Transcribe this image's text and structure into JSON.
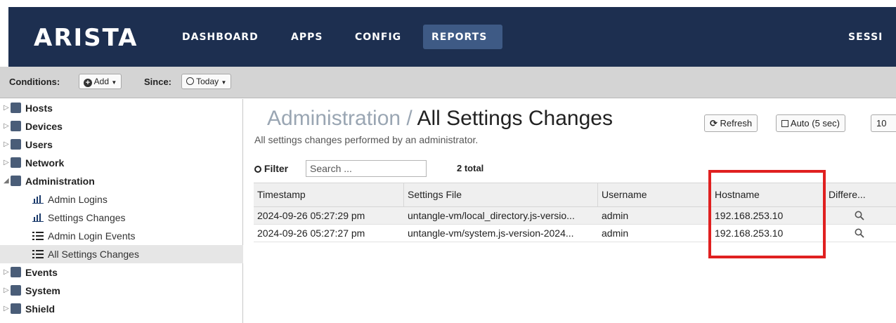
{
  "brand": {
    "logo": "ARISTA"
  },
  "nav": {
    "items": [
      "DASHBOARD",
      "APPS",
      "CONFIG",
      "REPORTS",
      "SESSI"
    ],
    "active": "REPORTS"
  },
  "toolbar": {
    "conditions_label": "Conditions:",
    "add_label": "Add",
    "since_label": "Since:",
    "since_value": "Today"
  },
  "sidebar": {
    "items": [
      {
        "label": "Hosts",
        "arrow": "▷"
      },
      {
        "label": "Devices",
        "arrow": "▷"
      },
      {
        "label": "Users",
        "arrow": "▷"
      },
      {
        "label": "Network",
        "arrow": "▷"
      },
      {
        "label": "Administration",
        "arrow": "◢"
      }
    ],
    "sub_items": [
      {
        "label": "Admin Logins",
        "icon": "bar-chart-icon"
      },
      {
        "label": "Settings Changes",
        "icon": "bar-chart-icon"
      },
      {
        "label": "Admin Login Events",
        "icon": "list-icon"
      },
      {
        "label": "All Settings Changes",
        "icon": "list-icon",
        "selected": true
      }
    ],
    "more_items": [
      {
        "label": "Events",
        "arrow": "▷"
      },
      {
        "label": "System",
        "arrow": "▷"
      },
      {
        "label": "Shield",
        "arrow": "▷"
      }
    ]
  },
  "header": {
    "parent": "Administration",
    "separator": "/",
    "title": "All Settings Changes",
    "subtitle": "All settings changes performed by an administrator."
  },
  "actions": {
    "refresh_label": "Refresh",
    "auto_label": "Auto (5 sec)",
    "limit_value": "10"
  },
  "filter": {
    "label": "Filter",
    "placeholder": "Search ...",
    "total": "2 total"
  },
  "table": {
    "columns": [
      "Timestamp",
      "Settings File",
      "Username",
      "Hostname",
      "Differe..."
    ],
    "rows": [
      [
        "2024-09-26 05:27:29 pm",
        "untangle-vm/local_directory.js-versio...",
        "admin",
        "192.168.253.10"
      ],
      [
        "2024-09-26 05:27:27 pm",
        "untangle-vm/system.js-version-2024...",
        "admin",
        "192.168.253.10"
      ]
    ]
  },
  "colors": {
    "topbar": "#1d2f50",
    "nav_active": "#3e5a85",
    "highlight": "#e02020"
  }
}
